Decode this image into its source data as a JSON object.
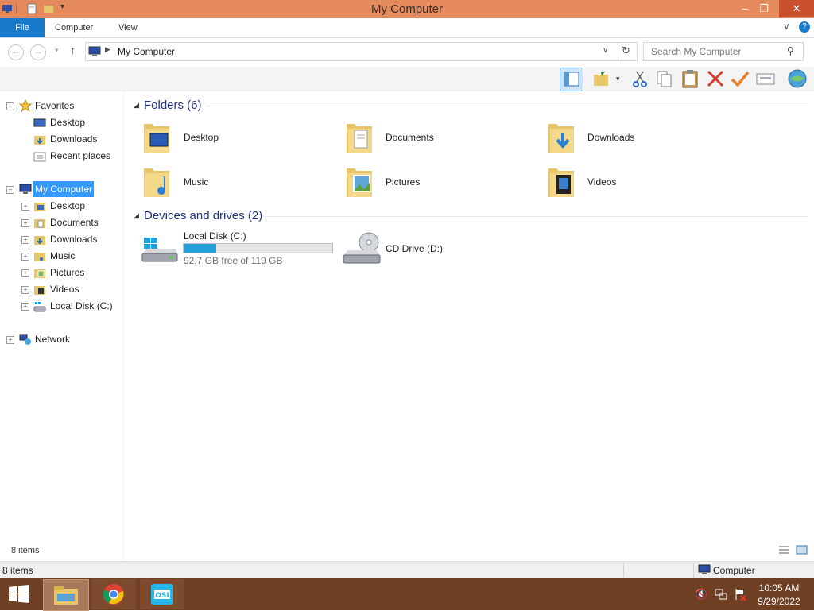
{
  "window": {
    "title": "My Computer"
  },
  "ribbon": {
    "tabs": [
      "File",
      "Computer",
      "View"
    ]
  },
  "address": {
    "path": "My Computer",
    "search_placeholder": "Search My Computer"
  },
  "nav": {
    "favorites_label": "Favorites",
    "favorites": [
      "Desktop",
      "Downloads",
      "Recent places"
    ],
    "computer_label": "My Computer",
    "computer_items": [
      "Desktop",
      "Documents",
      "Downloads",
      "Music",
      "Pictures",
      "Videos",
      "Local Disk (C:)"
    ],
    "network_label": "Network"
  },
  "content": {
    "folders_header": "Folders (6)",
    "folders": [
      "Desktop",
      "Documents",
      "Downloads",
      "Music",
      "Pictures",
      "Videos"
    ],
    "drives_header": "Devices and drives (2)",
    "drives": [
      {
        "name": "Local Disk (C:)",
        "free_text": "92.7 GB free of 119 GB",
        "used_fraction": 0.22
      },
      {
        "name": "CD Drive (D:)"
      }
    ]
  },
  "status": {
    "items_upper": "8 items",
    "items_lower": "8 items",
    "location": "Computer"
  },
  "taskbar": {
    "time": "10:05 AM",
    "date": "9/29/2022"
  },
  "colors": {
    "titlebar": "#e58a5c",
    "accent": "#1979ca",
    "taskbar": "#6f3f24",
    "selection": "#3399ff",
    "progress": "#26a0da"
  }
}
